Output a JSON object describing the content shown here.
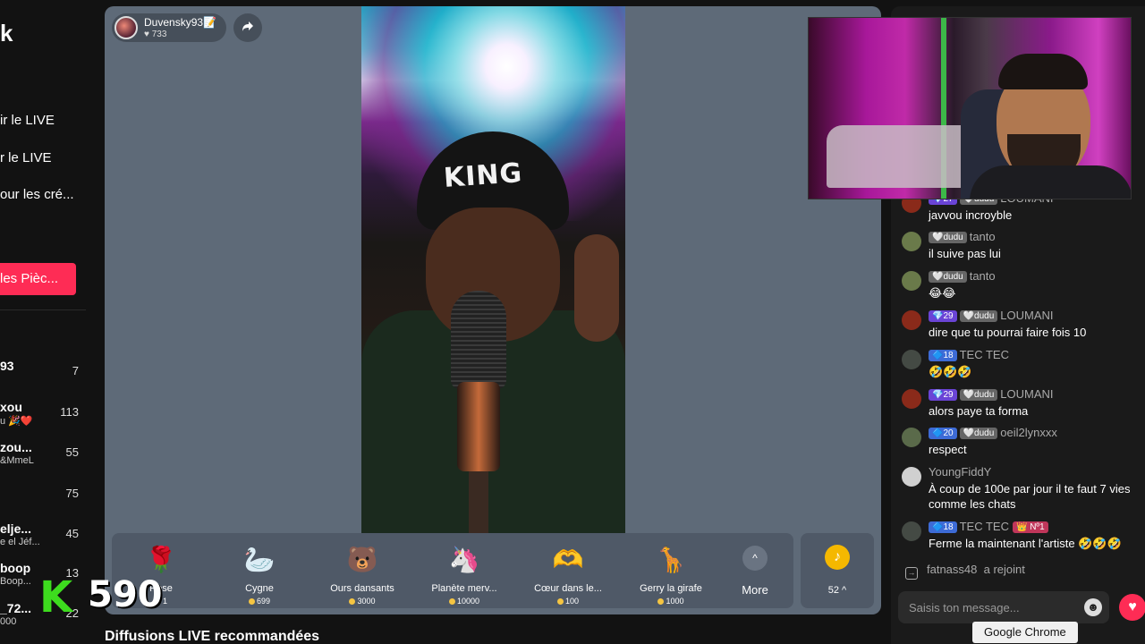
{
  "sidebar": {
    "logo_fragment": "k",
    "nav": [
      {
        "label": "ir le LIVE"
      },
      {
        "label": "r le LIVE"
      },
      {
        "label": "our les cré..."
      }
    ],
    "coins_button": "les Pièc...",
    "viewers": [
      {
        "name": "93",
        "sub": "",
        "count": "7"
      },
      {
        "name": "xou",
        "sub": "u 🎉❤️",
        "count": "113"
      },
      {
        "name": "zou...",
        "sub": "&MmeL",
        "count": "55"
      },
      {
        "name": "",
        "sub": "",
        "count": "75"
      },
      {
        "name": "elje...",
        "sub": "e el Jéf...",
        "count": "45"
      },
      {
        "name": "boop",
        "sub": "Boop...",
        "count": "13"
      },
      {
        "name": "_72...",
        "sub": "000",
        "count": "22"
      }
    ],
    "overlay": {
      "letter": "K",
      "number": "590"
    }
  },
  "live": {
    "host_name": "Duvensky93📝",
    "host_likes": "♥ 733",
    "share_icon": "share-arrow-icon",
    "beanie_text": "KING"
  },
  "gifts": [
    {
      "icon": "🌹",
      "name": "Rose",
      "price": "1"
    },
    {
      "icon": "🦢",
      "name": "Cygne",
      "price": "699"
    },
    {
      "icon": "🐻",
      "name": "Ours dansants",
      "price": "3000"
    },
    {
      "icon": "🦄",
      "name": "Planète merv...",
      "price": "10000"
    },
    {
      "icon": "🫶",
      "name": "Cœur dans le...",
      "price": "100"
    },
    {
      "icon": "🦒",
      "name": "Gerry la girafe",
      "price": "1000"
    }
  ],
  "more": {
    "label": "More",
    "chevron": "^"
  },
  "coins": {
    "count": "52 ^",
    "icon": "♪"
  },
  "reco_title": "Diffusions LIVE recommandées",
  "chat": {
    "messages": [
      {
        "badges": [
          {
            "t": "💎27",
            "c": "purple"
          },
          {
            "t": "🤍dudu",
            "c": "grey"
          }
        ],
        "user": "LOUMANI",
        "text": "javvou incroyble",
        "avatar": "#8a2a1a"
      },
      {
        "badges": [
          {
            "t": "🤍dudu",
            "c": "grey"
          }
        ],
        "user": "tanto",
        "text": "il suive pas lui",
        "avatar": "#6a7a4a"
      },
      {
        "badges": [
          {
            "t": "🤍dudu",
            "c": "grey"
          }
        ],
        "user": "tanto",
        "text": "😂😂",
        "avatar": "#6a7a4a"
      },
      {
        "badges": [
          {
            "t": "💎29",
            "c": "purple"
          },
          {
            "t": "🤍dudu",
            "c": "grey"
          }
        ],
        "user": "LOUMANI",
        "text": "dire que tu pourrai faire fois 10",
        "avatar": "#8a2a1a"
      },
      {
        "badges": [
          {
            "t": "🔷18",
            "c": "blue"
          }
        ],
        "user": "TEC TEC",
        "text": "🤣🤣🤣",
        "avatar": "#444a44"
      },
      {
        "badges": [
          {
            "t": "💎29",
            "c": "purple"
          },
          {
            "t": "🤍dudu",
            "c": "grey"
          }
        ],
        "user": "LOUMANI",
        "text": "alors paye ta forma",
        "avatar": "#8a2a1a"
      },
      {
        "badges": [
          {
            "t": "🔷20",
            "c": "blue"
          },
          {
            "t": "🤍dudu",
            "c": "grey"
          }
        ],
        "user": "oeil2lynxxx",
        "text": "respect",
        "avatar": "#5a6a4a"
      },
      {
        "badges": [],
        "user": "YoungFiddY",
        "text": "À coup de 100e par jour il te faut 7 vies comme les chats",
        "avatar": "#d0d0d0"
      },
      {
        "badges": [
          {
            "t": "🔷18",
            "c": "blue"
          }
        ],
        "user": "TEC TEC",
        "badge2": "👑 Nº1",
        "text": "Ferme la maintenant l'artiste 🤣🤣🤣",
        "avatar": "#444a44"
      }
    ],
    "join": {
      "user": "fatnass48",
      "action": "a rejoint"
    },
    "input_placeholder": "Saisis ton message...",
    "emoji_icon": "☻",
    "heart_icon": "♥"
  },
  "tooltip": "Google Chrome",
  "colors": {
    "accent": "#fe2c55",
    "panel": "#5e6a78",
    "k_green": "#3ddc1e"
  }
}
